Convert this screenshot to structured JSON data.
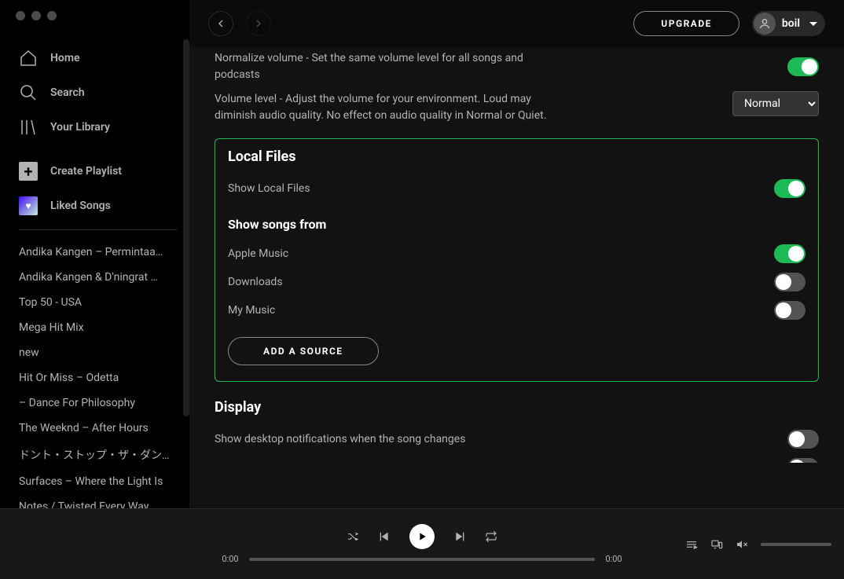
{
  "sidebar": {
    "home": "Home",
    "search": "Search",
    "library": "Your Library",
    "create_playlist": "Create Playlist",
    "liked_songs": "Liked Songs",
    "playlists": [
      "Andika Kangen – Permintaa…",
      "Andika Kangen & D'ningrat …",
      "Top 50 - USA",
      "Mega Hit Mix",
      "new",
      "Hit Or Miss – Odetta",
      "– Dance For Philosophy",
      "The Weeknd – After Hours",
      "ドント・ストップ・ザ・ダン…",
      "Surfaces – Where the Light Is",
      "Notes / Twisted Every Way …"
    ]
  },
  "topbar": {
    "upgrade": "UPGRADE",
    "username": "boil"
  },
  "settings": {
    "normalize_label": "Normalize volume - Set the same volume level for all songs and podcasts",
    "volume_level_label": "Volume level - Adjust the volume for your environment. Loud may diminish audio quality. No effect on audio quality in Normal or Quiet.",
    "volume_level_value": "Normal",
    "local_files_heading": "Local Files",
    "show_local_files": "Show Local Files",
    "show_songs_from": "Show songs from",
    "sources": {
      "apple_music": "Apple Music",
      "downloads": "Downloads",
      "my_music": "My Music"
    },
    "add_source": "ADD A SOURCE",
    "display_heading": "Display",
    "display_notif": "Show desktop notifications when the song changes"
  },
  "player": {
    "elapsed": "0:00",
    "total": "0:00"
  }
}
